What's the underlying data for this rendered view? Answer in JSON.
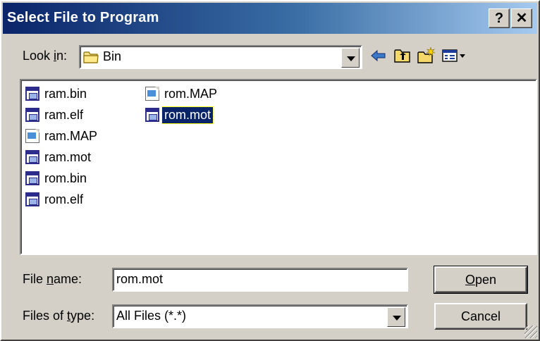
{
  "window": {
    "title": "Select File to Program",
    "help_button": "?",
    "close_button": "✕"
  },
  "look_in": {
    "label_pre": "Look ",
    "label_key": "i",
    "label_post": "n:",
    "value": "Bin"
  },
  "toolbar": {
    "back_icon": "back-arrow-icon",
    "up_icon": "up-folder-icon",
    "new_folder_icon": "new-folder-icon",
    "view_menu_icon": "view-menu-icon"
  },
  "files": [
    {
      "name": "ram.bin",
      "icon": "app"
    },
    {
      "name": "ram.elf",
      "icon": "app"
    },
    {
      "name": "ram.MAP",
      "icon": "doc"
    },
    {
      "name": "ram.mot",
      "icon": "app"
    },
    {
      "name": "rom.bin",
      "icon": "app"
    },
    {
      "name": "rom.elf",
      "icon": "app"
    },
    {
      "name": "rom.MAP",
      "icon": "doc"
    },
    {
      "name": "rom.mot",
      "icon": "app",
      "selected": true
    }
  ],
  "file_name": {
    "label_pre": "File ",
    "label_key": "n",
    "label_post": "ame:",
    "value": "rom.mot"
  },
  "file_type": {
    "label_pre": "Files of ",
    "label_key": "t",
    "label_post": "ype:",
    "value": "All Files (*.*)"
  },
  "buttons": {
    "open_key": "O",
    "open_rest": "pen",
    "cancel": "Cancel"
  },
  "colors": {
    "title_start": "#0a246a",
    "title_end": "#a6caf0",
    "dialog_bg": "#d4d0c8",
    "selection": "#0a246a"
  }
}
